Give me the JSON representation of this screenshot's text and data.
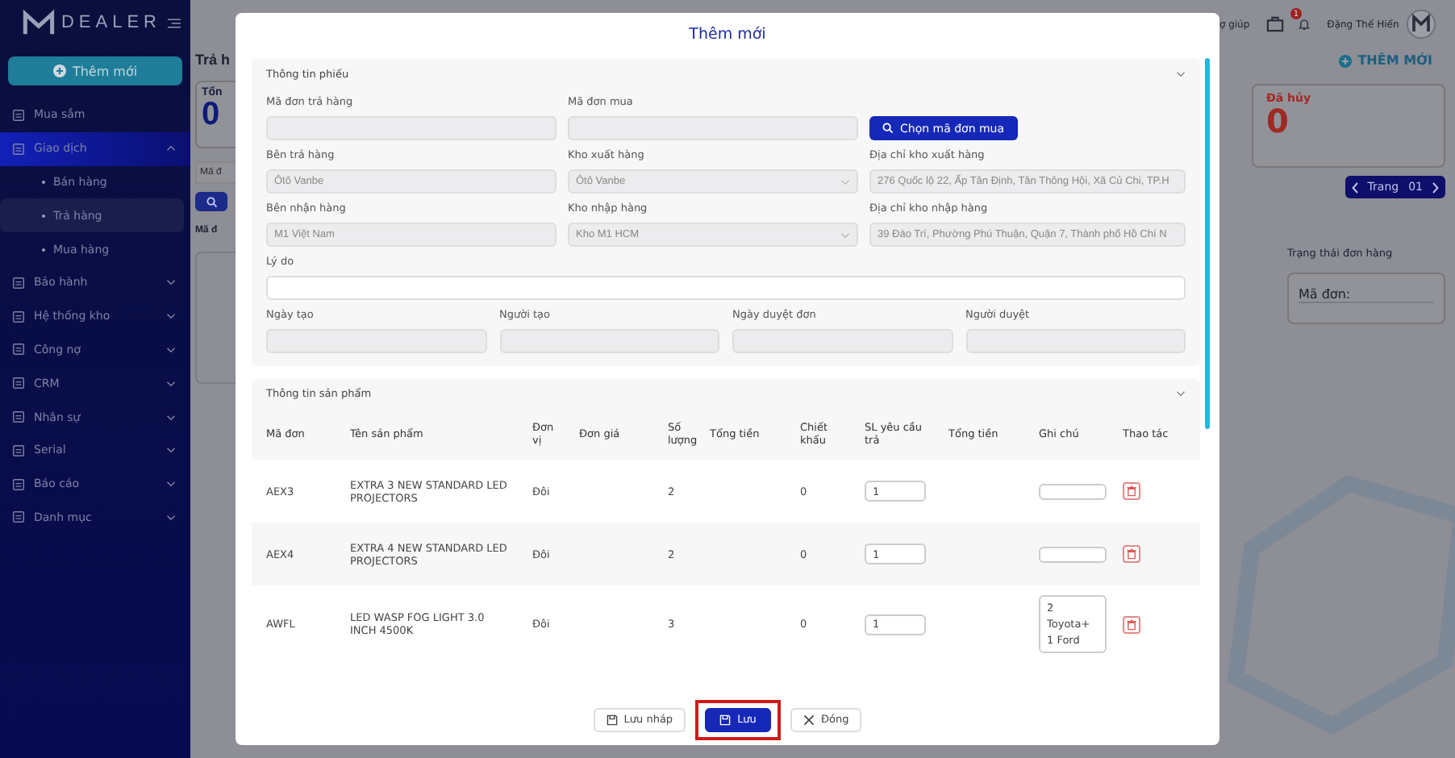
{
  "sidebar": {
    "logo_text": "DEALER",
    "add_button": "Thêm mới",
    "items": [
      {
        "label": "Mua sắm",
        "selected": false,
        "has_children": false
      },
      {
        "label": "Giao dịch",
        "expanded": true,
        "selected": true,
        "has_children": true,
        "children": [
          {
            "label": "Bán hàng",
            "selected": false
          },
          {
            "label": "Trả hàng",
            "selected": true
          },
          {
            "label": "Mua hàng",
            "selected": false
          }
        ]
      },
      {
        "label": "Bảo hành",
        "expanded": false,
        "selected": false,
        "has_children": true
      },
      {
        "label": "Hệ thống kho",
        "expanded": false,
        "selected": false,
        "has_children": true
      },
      {
        "label": "Công nợ",
        "expanded": false,
        "selected": false,
        "has_children": true
      },
      {
        "label": "CRM",
        "expanded": false,
        "selected": false,
        "has_children": true
      },
      {
        "label": "Nhân sự",
        "expanded": false,
        "selected": false,
        "has_children": true
      },
      {
        "label": "Serial",
        "expanded": false,
        "selected": false,
        "has_children": true
      },
      {
        "label": "Báo cáo",
        "expanded": false,
        "selected": false,
        "has_children": true
      },
      {
        "label": "Danh mục",
        "expanded": false,
        "selected": false,
        "has_children": true
      }
    ]
  },
  "page": {
    "title": "Trả h",
    "stat_left": {
      "label": "Tổn",
      "value": "0"
    },
    "filter": {
      "placeholder": "Mã đ"
    },
    "column_1": "Mã đ",
    "header": {
      "help": "ợ giúp",
      "cart_badge": "1",
      "user_name": "Đặng Thế Hiển"
    },
    "add_button": "THÊM MỚI",
    "stat_right": {
      "label": "Đã hủy",
      "value": "0"
    },
    "pager": {
      "label": "Trang",
      "page": "01"
    },
    "status_title": "Trạng thái đơn hàng",
    "order_card": "Mã đơn:"
  },
  "modal": {
    "title": "Thêm mới",
    "info_section": {
      "title": "Thông tin phiếu",
      "expanded": true,
      "fields": [
        {
          "label": "Mã đơn trả hàng",
          "kind": "text",
          "disabled": true
        },
        {
          "label": "Mã đơn mua",
          "kind": "text",
          "disabled": true
        },
        {
          "kind": "button",
          "text": "Chọn mã đơn mua"
        },
        {
          "label": "Bên trả hàng",
          "kind": "text",
          "disabled": true,
          "value": "Ôtô Vanbe"
        },
        {
          "label": "Kho xuất hàng",
          "kind": "select",
          "disabled": true,
          "value": "Ôtô Vanbe"
        },
        {
          "label": "Địa chỉ kho xuất hàng",
          "kind": "text",
          "disabled": true,
          "value": "276 Quốc lộ 22, Ấp Tân Định, Tân Thông Hội, Xã Củ Chi, TP.H"
        },
        {
          "label": "Bên nhận hàng",
          "kind": "text",
          "disabled": true,
          "value": "M1 Việt Nam"
        },
        {
          "label": "Kho nhập hàng",
          "kind": "select",
          "disabled": true,
          "value": "Kho M1 HCM"
        },
        {
          "label": "Địa chỉ kho nhập hàng",
          "kind": "text",
          "disabled": true,
          "value": "39 Đào Trí, Phường Phú Thuận, Quận 7, Thành phố Hồ Chí N"
        }
      ],
      "reason": {
        "label": "Lý do",
        "disabled": false
      },
      "meta_fields": [
        {
          "label": "Ngày tạo",
          "disabled": true
        },
        {
          "label": "Người tạo",
          "disabled": true
        },
        {
          "label": "Ngày duyệt đơn",
          "disabled": true
        },
        {
          "label": "Người duyệt",
          "disabled": true
        }
      ]
    },
    "product_section": {
      "title": "Thông tin sản phẩm",
      "expanded": true,
      "columns": [
        "Mã đơn",
        "Tên sản phẩm",
        "Đơn vị",
        "Đơn giá",
        "Số lượng",
        "Tổng tiền",
        "Chiết khấu",
        "SL yêu cầu trả",
        "Tổng tiền",
        "Ghi chú",
        "Thao tác"
      ],
      "rows": [
        {
          "code": "AEX3",
          "name": "EXTRA 3 NEW STANDARD LED PROJECTORS",
          "unit": "Đôi",
          "quantity": "2",
          "discount": "0",
          "return_qty": "1",
          "note": ""
        },
        {
          "code": "AEX4",
          "name": "EXTRA 4 NEW STANDARD LED PROJECTORS",
          "unit": "Đôi",
          "quantity": "2",
          "discount": "0",
          "return_qty": "1",
          "note": ""
        },
        {
          "code": "AWFL",
          "name": "LED WASP FOG LIGHT 3.0 INCH 4500K",
          "unit": "Đôi",
          "quantity": "3",
          "discount": "0",
          "return_qty": "1",
          "note": "2 Toyota+ 1 Ford"
        }
      ]
    },
    "buttons": [
      {
        "label": "Lưu nháp",
        "kind": "draft",
        "highlighted": false
      },
      {
        "label": "Lưu",
        "kind": "primary",
        "highlighted": true
      },
      {
        "label": "Đóng",
        "kind": "close",
        "highlighted": false
      }
    ]
  }
}
